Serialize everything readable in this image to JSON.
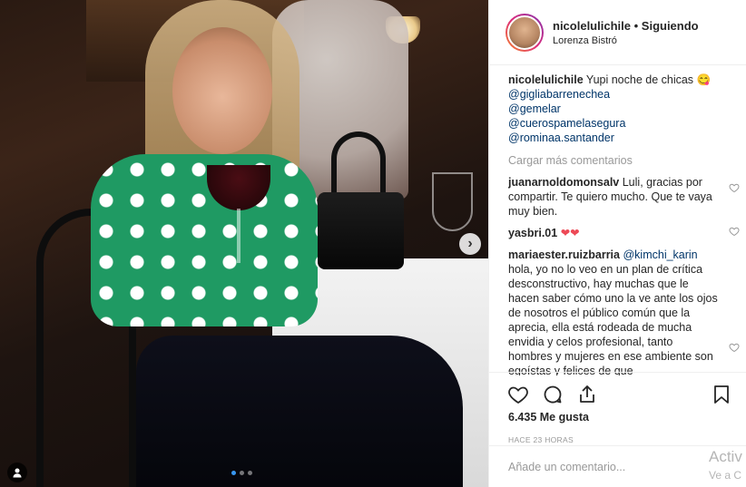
{
  "post": {
    "photo_alt": "",
    "carousel": {
      "count": 3,
      "active": 0
    }
  },
  "header": {
    "username": "nicolelulichile",
    "separator": "•",
    "follow_status": "Siguiendo",
    "location": "Lorenza Bistró"
  },
  "caption": {
    "username": "nicolelulichile",
    "text": "Yupi noche de chicas 😋",
    "mentions": [
      "@gigliabarrenechea",
      "@gemelar",
      "@cuerospamelasegura",
      "@rominaa.santander"
    ]
  },
  "load_more": "Cargar más comentarios",
  "comments": [
    {
      "user": "juanarnoldomonsalv",
      "text": "Luli, gracias por compartir. Te quiero mucho. Que te vaya muy bien."
    },
    {
      "user": "yasbri.01",
      "text": "❤❤"
    },
    {
      "user": "mariaester.ruizbarria",
      "mention": "@kimchi_karin",
      "text": "hola, yo no lo veo en un plan de crítica desconstructivo, hay muchas que le hacen saber cómo uno la ve ante los ojos de nosotros el público común que la aprecia, ella está rodeada de mucha envidia y celos profesional, tanto hombres y mujeres en ese ambiente son egoístas y felices de que"
    }
  ],
  "likes": "6.435 Me gusta",
  "time": "HACE 23 HORAS",
  "add_comment_placeholder": "Añade un comentario...",
  "watermark": {
    "line1": "Activ",
    "line2": "Ve a C"
  },
  "icons": {
    "like": "heart-icon",
    "comment": "comment-icon",
    "share": "share-icon",
    "save": "bookmark-icon",
    "next": "chevron-right-icon",
    "tag": "user-tag-icon"
  },
  "colors": {
    "link": "#003569",
    "muted": "#999999",
    "accent_dot": "#3897f0",
    "heart_red": "#ed4956"
  }
}
